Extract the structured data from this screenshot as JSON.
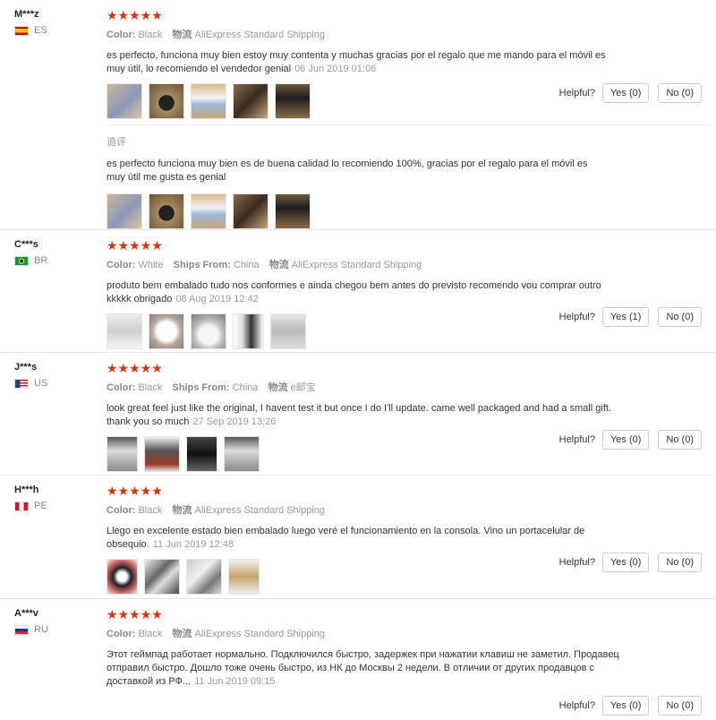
{
  "labels": {
    "color": "Color:",
    "ships_from": "Ships From:",
    "logistics": "物流",
    "helpful": "Helpful?",
    "additional": "追评"
  },
  "stars": "★★★★★",
  "reviews": [
    {
      "user": "M***z",
      "country": "ES",
      "color": "Black",
      "logistics": "AliExpress Standard Shipping",
      "text": "es perfecto, funciona muy bien estoy muy contenta y muchas gracias por el regalo que me mando para el móvil es muy útil, lo recomiendo el vendedor genial",
      "date": "06 Jun 2019 01:06",
      "yes": "Yes (0)",
      "no": "No (0)",
      "additional_text": "es perfecto funciona muy bien es de buena calidad lo recomiendo 100%, gracias por el regalo para el móvil es muy útil me gusta es genial"
    },
    {
      "user": "C***s",
      "country": "BR",
      "color": "White",
      "ships_from": "China",
      "logistics": "AliExpress Standard Shipping",
      "text": "produto bem embalado tudo nos conformes e ainda chegou bem antes do previsto recomendo vou comprar outro kkkkk obrigado",
      "date": "08 Aug 2019 12:42",
      "yes": "Yes (1)",
      "no": "No (0)"
    },
    {
      "user": "J***s",
      "country": "US",
      "color": "Black",
      "ships_from": "China",
      "logistics": "e邮宝",
      "text": "look great feel just like the original, I havent test it but once I do I'll update. came well packaged and had a small gift. thank you so much",
      "date": "27 Sep 2019 13:26",
      "yes": "Yes (0)",
      "no": "No (0)"
    },
    {
      "user": "H***h",
      "country": "PE",
      "color": "Black",
      "logistics": "AliExpress Standard Shipping",
      "text": "Llego en excelente estado bien embalado luego veré el funcionamiento en la consola. Vino un portacelular de obsequio.",
      "date": "11 Jun 2019 12:48",
      "yes": "Yes (0)",
      "no": "No (0)"
    },
    {
      "user": "A***v",
      "country": "RU",
      "color": "Black",
      "logistics": "AliExpress Standard Shipping",
      "text": "Этот геймпад работает нормально. Подключился быстро, задержек при нажатии клавиш не заметил. Продавец отправил быстро. Дошло тоже очень быстро, из НК до Москвы 2 недели. В отличии от других продавцов с доставкой из РФ...",
      "date": "11 Jun 2019 09:15",
      "yes": "Yes (0)",
      "no": "No (0)"
    }
  ]
}
